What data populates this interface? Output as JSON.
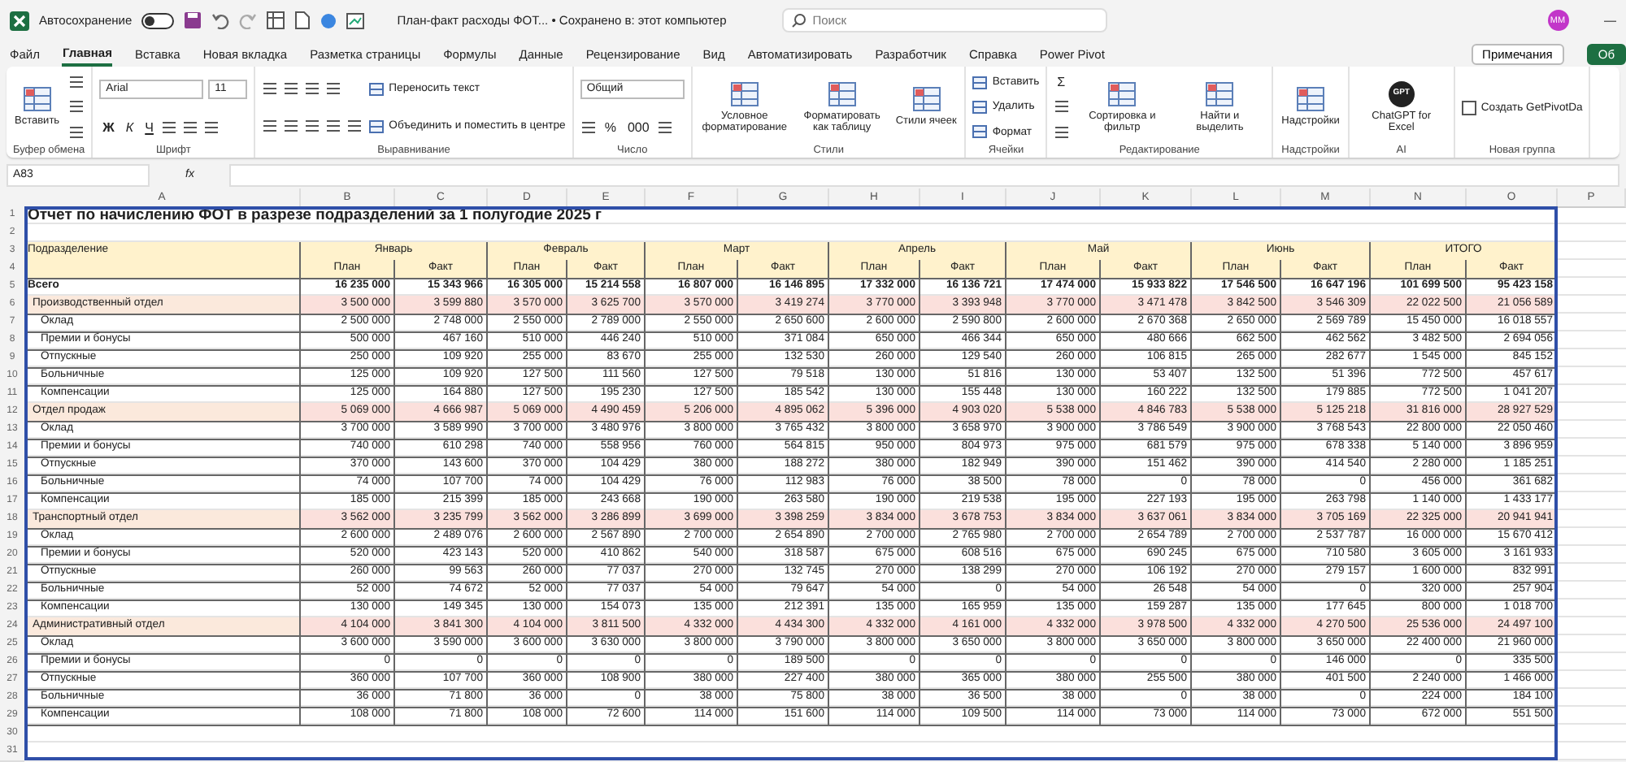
{
  "titlebar": {
    "autosave_label": "Автосохранение",
    "autosave_on": false,
    "document": "План-факт расходы ФОТ... • Сохранено в: этот компьютер",
    "search_placeholder": "Поиск",
    "avatar": "ММ",
    "minimize": "—"
  },
  "tabs": [
    {
      "label": "Файл",
      "selected": false
    },
    {
      "label": "Главная",
      "selected": true
    },
    {
      "label": "Вставка",
      "selected": false
    },
    {
      "label": "Новая вкладка",
      "selected": false
    },
    {
      "label": "Разметка страницы",
      "selected": false
    },
    {
      "label": "Формулы",
      "selected": false
    },
    {
      "label": "Данные",
      "selected": false
    },
    {
      "label": "Рецензирование",
      "selected": false
    },
    {
      "label": "Вид",
      "selected": false
    },
    {
      "label": "Автоматизировать",
      "selected": false
    },
    {
      "label": "Разработчик",
      "selected": false
    },
    {
      "label": "Справка",
      "selected": false
    },
    {
      "label": "Power Pivot",
      "selected": false
    }
  ],
  "tab_buttons": [
    {
      "kind": "comments",
      "label": "Примечания"
    },
    {
      "kind": "share",
      "label": "Об"
    }
  ],
  "ribbon": {
    "groups": [
      {
        "title": "Буфер обмена",
        "columns": [
          [
            [
              {
                "kind": "big",
                "label": "Вставить"
              }
            ]
          ],
          [
            [
              {
                "kind": "icon"
              }
            ],
            [
              {
                "kind": "icon"
              }
            ],
            [
              {
                "kind": "icon"
              }
            ]
          ]
        ]
      },
      {
        "title": "Шрифт",
        "columns": [
          [
            [
              {
                "kind": "field-wide",
                "value": "Arial"
              },
              {
                "kind": "field",
                "value": "11"
              }
            ],
            [
              {
                "kind": "glyph-bold",
                "label": "Ж"
              },
              {
                "kind": "glyph-italic",
                "label": "К"
              },
              {
                "kind": "glyph-underline",
                "label": "Ч"
              },
              {
                "kind": "icon"
              },
              {
                "kind": "icon"
              },
              {
                "kind": "icon"
              }
            ]
          ]
        ]
      },
      {
        "title": "Выравнивание",
        "columns": [
          [
            [
              {
                "kind": "icon"
              },
              {
                "kind": "icon"
              },
              {
                "kind": "icon"
              },
              {
                "kind": "icon"
              }
            ],
            [
              {
                "kind": "icon"
              },
              {
                "kind": "icon"
              },
              {
                "kind": "icon"
              },
              {
                "kind": "icon"
              },
              {
                "kind": "icon"
              }
            ]
          ],
          [
            [
              {
                "kind": "small",
                "label": "Переносить текст"
              }
            ],
            [
              {
                "kind": "small",
                "label": "Объединить и поместить в центре"
              }
            ]
          ]
        ]
      },
      {
        "title": "Число",
        "columns": [
          [
            [
              {
                "kind": "field-wide",
                "value": "Общий"
              }
            ],
            [
              {
                "kind": "icon"
              },
              {
                "kind": "glyph",
                "label": "%"
              },
              {
                "kind": "glyph",
                "label": "000"
              },
              {
                "kind": "icon"
              }
            ]
          ]
        ]
      },
      {
        "title": "Стили",
        "columns": [
          [
            [
              {
                "kind": "big",
                "label": "Условное форматирование"
              }
            ]
          ],
          [
            [
              {
                "kind": "big",
                "label": "Форматировать как таблицу"
              }
            ]
          ],
          [
            [
              {
                "kind": "big",
                "label": "Стили ячеек"
              }
            ]
          ]
        ]
      },
      {
        "title": "Ячейки",
        "columns": [
          [
            [
              {
                "kind": "small",
                "label": "Вставить"
              }
            ],
            [
              {
                "kind": "small",
                "label": "Удалить"
              }
            ],
            [
              {
                "kind": "small",
                "label": "Формат"
              }
            ]
          ]
        ]
      },
      {
        "title": "Редактирование",
        "columns": [
          [
            [
              {
                "kind": "glyph",
                "label": "Σ"
              }
            ],
            [
              {
                "kind": "icon"
              }
            ],
            [
              {
                "kind": "icon"
              }
            ]
          ],
          [
            [
              {
                "kind": "big",
                "label": "Сортировка и фильтр"
              }
            ]
          ],
          [
            [
              {
                "kind": "big",
                "label": "Найти и выделить"
              }
            ]
          ]
        ]
      },
      {
        "title": "Надстройки",
        "columns": [
          [
            [
              {
                "kind": "big",
                "label": "Надстройки"
              }
            ]
          ]
        ]
      },
      {
        "title": "AI",
        "columns": [
          [
            [
              {
                "kind": "gpt",
                "badge": "GPT",
                "label": "ChatGPT for Excel"
              }
            ]
          ]
        ]
      },
      {
        "title": "Новая группа",
        "columns": [
          [
            [
              {
                "kind": "checkbox",
                "label": "Создать GetPivotDa",
                "checked": false
              }
            ]
          ]
        ]
      }
    ]
  },
  "formula_bar": {
    "name_box": "A83",
    "fx": "fx"
  },
  "sheet": {
    "column_letters": [
      "A",
      "B",
      "C",
      "D",
      "E",
      "F",
      "G",
      "H",
      "I",
      "J",
      "K",
      "L",
      "M",
      "N",
      "O",
      "P"
    ],
    "rows": [
      {
        "num": "1",
        "kind": "title",
        "text": "Отчет по начислению ФОТ в разрезе подразделений за 1 полугодие  2025 г"
      },
      {
        "num": "2",
        "kind": "blank"
      },
      {
        "num": "3",
        "kind": "months",
        "label": "Подразделение",
        "months": [
          "Январь",
          "Февраль",
          "Март",
          "Апрель",
          "Май",
          "Июнь",
          "ИТОГО"
        ]
      },
      {
        "num": "4",
        "kind": "planfact",
        "cells": [
          "План",
          "Факт",
          "План",
          "Факт",
          "План",
          "Факт",
          "План",
          "Факт",
          "План",
          "Факт",
          "План",
          "Факт",
          "План",
          "Факт"
        ]
      },
      {
        "num": "5",
        "kind": "total",
        "label": "Всего",
        "cells": [
          "16 235 000",
          "15 343 966",
          "16 305 000",
          "15 214 558",
          "16 807 000",
          "16 146 895",
          "17 332 000",
          "16 136 721",
          "17 474 000",
          "15 933 822",
          "17 546 500",
          "16 647 196",
          "101 699 500",
          "95 423 158"
        ]
      },
      {
        "num": "6",
        "kind": "dept",
        "label": "Производственный отдел",
        "cells": [
          "3 500 000",
          "3 599 880",
          "3 570 000",
          "3 625 700",
          "3 570 000",
          "3 419 274",
          "3 770 000",
          "3 393 948",
          "3 770 000",
          "3 471 478",
          "3 842 500",
          "3 546 309",
          "22 022 500",
          "21 056 589"
        ]
      },
      {
        "num": "7",
        "kind": "item",
        "label": "Оклад",
        "cells": [
          "2 500 000",
          "2 748 000",
          "2 550 000",
          "2 789 000",
          "2 550 000",
          "2 650 600",
          "2 600 000",
          "2 590 800",
          "2 600 000",
          "2 670 368",
          "2 650 000",
          "2 569 789",
          "15 450 000",
          "16 018 557"
        ]
      },
      {
        "num": "8",
        "kind": "item",
        "label": "Премии и бонусы",
        "cells": [
          "500 000",
          "467 160",
          "510 000",
          "446 240",
          "510 000",
          "371 084",
          "650 000",
          "466 344",
          "650 000",
          "480 666",
          "662 500",
          "462 562",
          "3 482 500",
          "2 694 056"
        ]
      },
      {
        "num": "9",
        "kind": "item",
        "label": "Отпускные",
        "cells": [
          "250 000",
          "109 920",
          "255 000",
          "83 670",
          "255 000",
          "132 530",
          "260 000",
          "129 540",
          "260 000",
          "106 815",
          "265 000",
          "282 677",
          "1 545 000",
          "845 152"
        ]
      },
      {
        "num": "10",
        "kind": "item",
        "label": "Больничные",
        "cells": [
          "125 000",
          "109 920",
          "127 500",
          "111 560",
          "127 500",
          "79 518",
          "130 000",
          "51 816",
          "130 000",
          "53 407",
          "132 500",
          "51 396",
          "772 500",
          "457 617"
        ]
      },
      {
        "num": "11",
        "kind": "item",
        "label": "Компенсации",
        "cells": [
          "125 000",
          "164 880",
          "127 500",
          "195 230",
          "127 500",
          "185 542",
          "130 000",
          "155 448",
          "130 000",
          "160 222",
          "132 500",
          "179 885",
          "772 500",
          "1 041 207"
        ]
      },
      {
        "num": "12",
        "kind": "dept",
        "label": "Отдел продаж",
        "cells": [
          "5 069 000",
          "4 666 987",
          "5 069 000",
          "4 490 459",
          "5 206 000",
          "4 895 062",
          "5 396 000",
          "4 903 020",
          "5 538 000",
          "4 846 783",
          "5 538 000",
          "5 125 218",
          "31 816 000",
          "28 927 529"
        ]
      },
      {
        "num": "13",
        "kind": "item",
        "label": "Оклад",
        "cells": [
          "3 700 000",
          "3 589 990",
          "3 700 000",
          "3 480 976",
          "3 800 000",
          "3 765 432",
          "3 800 000",
          "3 658 970",
          "3 900 000",
          "3 786 549",
          "3 900 000",
          "3 768 543",
          "22 800 000",
          "22 050 460"
        ]
      },
      {
        "num": "14",
        "kind": "item",
        "label": "Премии и бонусы",
        "cells": [
          "740 000",
          "610 298",
          "740 000",
          "558 956",
          "760 000",
          "564 815",
          "950 000",
          "804 973",
          "975 000",
          "681 579",
          "975 000",
          "678 338",
          "5 140 000",
          "3 896 959"
        ]
      },
      {
        "num": "15",
        "kind": "item",
        "label": "Отпускные",
        "cells": [
          "370 000",
          "143 600",
          "370 000",
          "104 429",
          "380 000",
          "188 272",
          "380 000",
          "182 949",
          "390 000",
          "151 462",
          "390 000",
          "414 540",
          "2 280 000",
          "1 185 251"
        ]
      },
      {
        "num": "16",
        "kind": "item",
        "label": "Больничные",
        "cells": [
          "74 000",
          "107 700",
          "74 000",
          "104 429",
          "76 000",
          "112 983",
          "76 000",
          "38 500",
          "78 000",
          "0",
          "78 000",
          "0",
          "456 000",
          "361 682"
        ]
      },
      {
        "num": "17",
        "kind": "item",
        "label": "Компенсации",
        "cells": [
          "185 000",
          "215 399",
          "185 000",
          "243 668",
          "190 000",
          "263 580",
          "190 000",
          "219 538",
          "195 000",
          "227 193",
          "195 000",
          "263 798",
          "1 140 000",
          "1 433 177"
        ]
      },
      {
        "num": "18",
        "kind": "dept",
        "label": "Транспортный отдел",
        "cells": [
          "3 562 000",
          "3 235 799",
          "3 562 000",
          "3 286 899",
          "3 699 000",
          "3 398 259",
          "3 834 000",
          "3 678 753",
          "3 834 000",
          "3 637 061",
          "3 834 000",
          "3 705 169",
          "22 325 000",
          "20 941 941"
        ]
      },
      {
        "num": "19",
        "kind": "item",
        "label": "Оклад",
        "cells": [
          "2 600 000",
          "2 489 076",
          "2 600 000",
          "2 567 890",
          "2 700 000",
          "2 654 890",
          "2 700 000",
          "2 765 980",
          "2 700 000",
          "2 654 789",
          "2 700 000",
          "2 537 787",
          "16 000 000",
          "15 670 412"
        ]
      },
      {
        "num": "20",
        "kind": "item",
        "label": "Премии и бонусы",
        "cells": [
          "520 000",
          "423 143",
          "520 000",
          "410 862",
          "540 000",
          "318 587",
          "675 000",
          "608 516",
          "675 000",
          "690 245",
          "675 000",
          "710 580",
          "3 605 000",
          "3 161 933"
        ]
      },
      {
        "num": "21",
        "kind": "item",
        "label": "Отпускные",
        "cells": [
          "260 000",
          "99 563",
          "260 000",
          "77 037",
          "270 000",
          "132 745",
          "270 000",
          "138 299",
          "270 000",
          "106 192",
          "270 000",
          "279 157",
          "1 600 000",
          "832 991"
        ]
      },
      {
        "num": "22",
        "kind": "item",
        "label": "Больничные",
        "cells": [
          "52 000",
          "74 672",
          "52 000",
          "77 037",
          "54 000",
          "79 647",
          "54 000",
          "0",
          "54 000",
          "26 548",
          "54 000",
          "0",
          "320 000",
          "257 904"
        ]
      },
      {
        "num": "23",
        "kind": "item",
        "label": "Компенсации",
        "cells": [
          "130 000",
          "149 345",
          "130 000",
          "154 073",
          "135 000",
          "212 391",
          "135 000",
          "165 959",
          "135 000",
          "159 287",
          "135 000",
          "177 645",
          "800 000",
          "1 018 700"
        ]
      },
      {
        "num": "24",
        "kind": "dept",
        "label": "Административный отдел",
        "cells": [
          "4 104 000",
          "3 841 300",
          "4 104 000",
          "3 811 500",
          "4 332 000",
          "4 434 300",
          "4 332 000",
          "4 161 000",
          "4 332 000",
          "3 978 500",
          "4 332 000",
          "4 270 500",
          "25 536 000",
          "24 497 100"
        ]
      },
      {
        "num": "25",
        "kind": "item",
        "label": "Оклад",
        "cells": [
          "3 600 000",
          "3 590 000",
          "3 600 000",
          "3 630 000",
          "3 800 000",
          "3 790 000",
          "3 800 000",
          "3 650 000",
          "3 800 000",
          "3 650 000",
          "3 800 000",
          "3 650 000",
          "22 400 000",
          "21 960 000"
        ]
      },
      {
        "num": "26",
        "kind": "item",
        "label": "Премии и бонусы",
        "cells": [
          "0",
          "0",
          "0",
          "0",
          "0",
          "189 500",
          "0",
          "0",
          "0",
          "0",
          "0",
          "146 000",
          "0",
          "335 500"
        ]
      },
      {
        "num": "27",
        "kind": "item",
        "label": "Отпускные",
        "cells": [
          "360 000",
          "107 700",
          "360 000",
          "108 900",
          "380 000",
          "227 400",
          "380 000",
          "365 000",
          "380 000",
          "255 500",
          "380 000",
          "401 500",
          "2 240 000",
          "1 466 000"
        ]
      },
      {
        "num": "28",
        "kind": "item",
        "label": "Больничные",
        "cells": [
          "36 000",
          "71 800",
          "36 000",
          "0",
          "38 000",
          "75 800",
          "38 000",
          "36 500",
          "38 000",
          "0",
          "38 000",
          "0",
          "224 000",
          "184 100"
        ]
      },
      {
        "num": "29",
        "kind": "item",
        "label": "Компенсации",
        "cells": [
          "108 000",
          "71 800",
          "108 000",
          "72 600",
          "114 000",
          "151 600",
          "114 000",
          "109 500",
          "114 000",
          "73 000",
          "114 000",
          "73 000",
          "672 000",
          "551 500"
        ]
      },
      {
        "num": "30",
        "kind": "blank"
      },
      {
        "num": "31",
        "kind": "blank"
      }
    ]
  }
}
